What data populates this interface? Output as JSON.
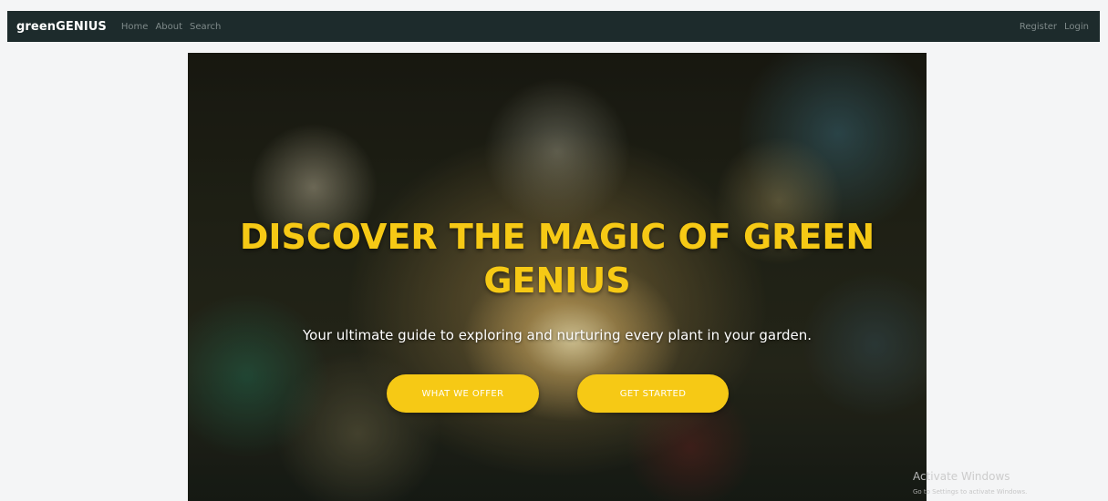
{
  "navbar": {
    "brand": "greenGENIUS",
    "left_links": [
      "Home",
      "About",
      "Search"
    ],
    "right_links": [
      "Register",
      "Login"
    ]
  },
  "hero": {
    "title": "DISCOVER THE MAGIC OF GREEN GENIUS",
    "subtitle": "Your ultimate guide to exploring and nurturing every plant in your garden.",
    "buttons": [
      "WHAT WE OFFER",
      "GET STARTED"
    ]
  },
  "watermark": {
    "title": "Activate Windows",
    "subtitle": "Go to Settings to activate Windows."
  },
  "colors": {
    "navbar_bg": "#1d2b2c",
    "accent": "#f6c915",
    "page_bg": "#f4f5f6"
  }
}
